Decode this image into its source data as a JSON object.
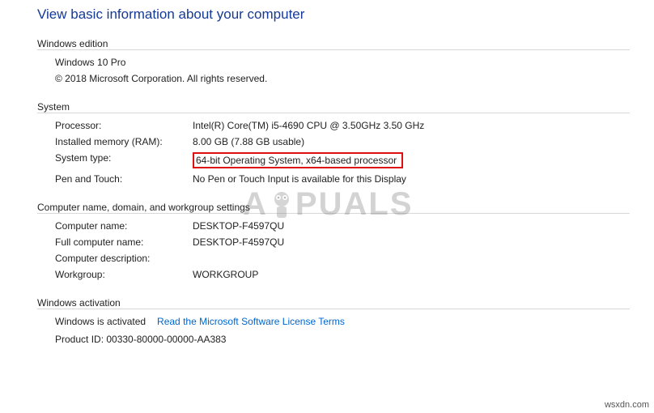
{
  "title": "View basic information about your computer",
  "windows_edition": {
    "header": "Windows edition",
    "name": "Windows 10 Pro",
    "copyright": "© 2018 Microsoft Corporation. All rights reserved."
  },
  "system": {
    "header": "System",
    "processor_label": "Processor:",
    "processor_value": "Intel(R) Core(TM) i5-4690 CPU @ 3.50GHz   3.50 GHz",
    "ram_label": "Installed memory (RAM):",
    "ram_value": "8.00 GB (7.88 GB usable)",
    "systype_label": "System type:",
    "systype_value": "64-bit Operating System, x64-based processor",
    "pen_label": "Pen and Touch:",
    "pen_value": "No Pen or Touch Input is available for this Display"
  },
  "computer": {
    "header": "Computer name, domain, and workgroup settings",
    "name_label": "Computer name:",
    "name_value": "DESKTOP-F4597QU",
    "fullname_label": "Full computer name:",
    "fullname_value": "DESKTOP-F4597QU",
    "desc_label": "Computer description:",
    "desc_value": "",
    "workgroup_label": "Workgroup:",
    "workgroup_value": "WORKGROUP"
  },
  "activation": {
    "header": "Windows activation",
    "status": "Windows is activated",
    "license_link": "Read the Microsoft Software License Terms",
    "product_id": "Product ID: 00330-80000-00000-AA383"
  },
  "watermark_left": "A",
  "watermark_right": "PUALS",
  "site_credit": "wsxdn.com"
}
